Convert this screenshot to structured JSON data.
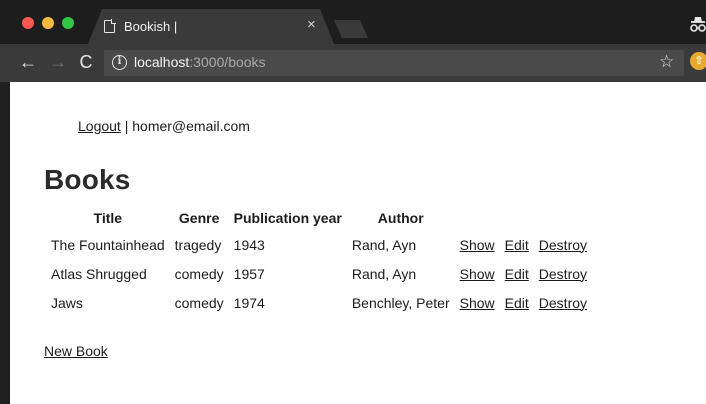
{
  "browser": {
    "tab_title": "Bookish |",
    "tab_close": "×",
    "url_host": "localhost",
    "url_path": ":3000/books",
    "back_glyph": "←",
    "forward_glyph": "→",
    "reload_glyph": "C",
    "star_glyph": "☆",
    "extension_glyph": "⇧"
  },
  "session": {
    "logout_label": "Logout",
    "separator": "|",
    "email": "homer@email.com"
  },
  "main": {
    "title": "Books",
    "columns": [
      "Title",
      "Genre",
      "Publication year",
      "Author"
    ],
    "rows": [
      {
        "title": "The Fountainhead",
        "genre": "tragedy",
        "year": "1943",
        "author": "Rand, Ayn",
        "show": "Show",
        "edit": "Edit",
        "destroy": "Destroy"
      },
      {
        "title": "Atlas Shrugged",
        "genre": "comedy",
        "year": "1957",
        "author": "Rand, Ayn",
        "show": "Show",
        "edit": "Edit",
        "destroy": "Destroy"
      },
      {
        "title": "Jaws",
        "genre": "comedy",
        "year": "1974",
        "author": "Benchley, Peter",
        "show": "Show",
        "edit": "Edit",
        "destroy": "Destroy"
      }
    ],
    "new_book_label": "New Book"
  },
  "colors": {
    "close_red": "#fc5753",
    "minimize_yellow": "#fdbc40",
    "zoom_green": "#33c748",
    "extension_orange": "#e9a830"
  }
}
